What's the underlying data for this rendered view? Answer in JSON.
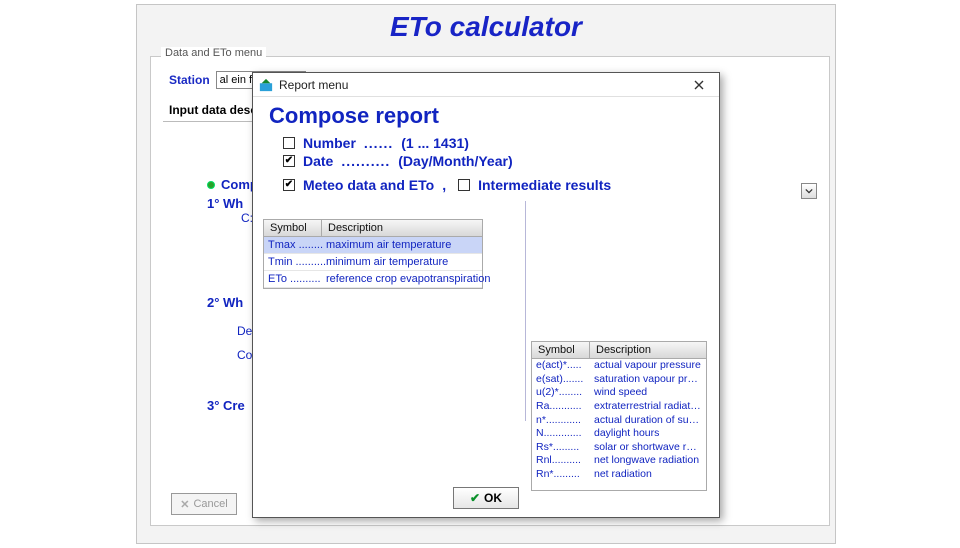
{
  "app": {
    "title": "ETo calculator"
  },
  "dataEtoWindow": {
    "tab": "Data and ETo menu",
    "station_label": "Station",
    "station_value": "al ein farm",
    "input_data_desc": "Input data descr",
    "composition_label": "Comp",
    "steps": {
      "s1": "1° Wh",
      "s1_path": "C:\\.",
      "s2": "2° Wh",
      "descrip": "Descrip",
      "conti": "Conti",
      "s3": "3° Cre"
    },
    "cancel": "Cancel"
  },
  "reportModal": {
    "title": "Report menu",
    "heading": "Compose report",
    "opts": {
      "number": {
        "checked": false,
        "label": "Number",
        "dots": "......",
        "extra": "(1 ... 1431)"
      },
      "date": {
        "checked": true,
        "label": "Date",
        "dots": "..........",
        "extra": "(Day/Month/Year)"
      },
      "meteo": {
        "checked": true,
        "label": "Meteo data and ETo",
        "sep": ",",
        "inter_checked": false,
        "inter_label": "Intermediate results"
      }
    },
    "table1": {
      "head_symbol": "Symbol",
      "head_desc": "Description",
      "rows": [
        {
          "sym": "Tmax",
          "dots": "........",
          "desc": "maximum air temperature",
          "selected": true
        },
        {
          "sym": "Tmin",
          "dots": "..........",
          "desc": "minimum air temperature",
          "selected": false
        },
        {
          "sym": "ETo",
          "dots": "..........",
          "desc": "reference crop evapotranspiration",
          "selected": false
        }
      ]
    },
    "table2": {
      "head_symbol": "Symbol",
      "head_desc": "Description",
      "rows": [
        {
          "sym": "e(act)*",
          "dots": ".....",
          "desc": "actual vapour pressure"
        },
        {
          "sym": "e(sat)",
          "dots": ".......",
          "desc": "saturation vapour pressure"
        },
        {
          "sym": "u(2)*",
          "dots": "........",
          "desc": "wind speed"
        },
        {
          "sym": "Ra",
          "dots": "...........",
          "desc": "extraterrestrial radiation"
        },
        {
          "sym": "n*",
          "dots": "............",
          "desc": "actual duration of sunshine in a day"
        },
        {
          "sym": "N",
          "dots": ".............",
          "desc": "daylight hours"
        },
        {
          "sym": "Rs*",
          "dots": ".........",
          "desc": "solar or shortwave radiation"
        },
        {
          "sym": "Rnl",
          "dots": "..........",
          "desc": "net longwave radiation"
        },
        {
          "sym": "Rn*",
          "dots": ".........",
          "desc": "net radiation"
        }
      ]
    },
    "ok": "OK"
  }
}
